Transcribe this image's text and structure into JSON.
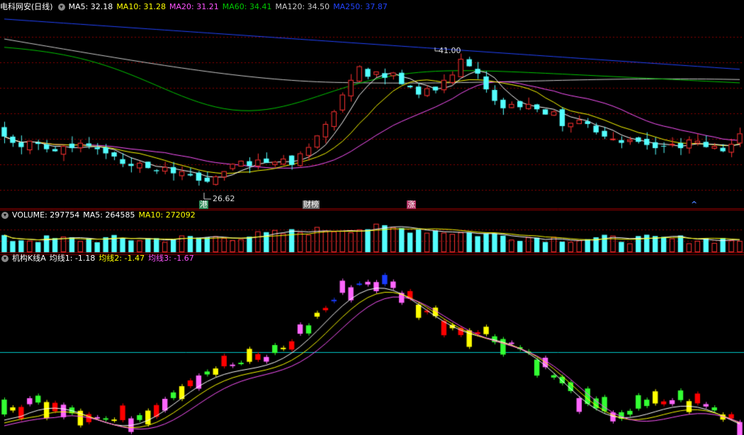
{
  "colors": {
    "bg": "#000000",
    "up": "#ff3232",
    "down": "#54ffff",
    "grid": "#8b0000",
    "ma5": "#ffffff",
    "ma10": "#ffff00",
    "ma20": "#ff55ff",
    "ma60": "#00c800",
    "ma120": "#cccccc",
    "ma250": "#2244ff",
    "line_cyan": "#00c8c8",
    "inst_red": "#ff0000",
    "inst_magenta": "#ff66ff",
    "inst_yellow": "#ffff00",
    "inst_green": "#33ff33",
    "inst_blue": "#1a3cff"
  },
  "price_panel": {
    "title": "电科网安(日线)",
    "ma_labels": [
      {
        "text": "MA5: 32.18",
        "color": "#ffffff"
      },
      {
        "text": "MA10: 31.28",
        "color": "#ffff00"
      },
      {
        "text": "MA20: 31.21",
        "color": "#ff55ff"
      },
      {
        "text": "MA60: 34.41",
        "color": "#00c800"
      },
      {
        "text": "MA120: 34.50",
        "color": "#cccccc"
      },
      {
        "text": "MA250: 37.87",
        "color": "#2244ff"
      }
    ],
    "high_label": "41.00",
    "low_label": "26.62",
    "markers": [
      {
        "text": "港",
        "bg": "#2e8b57",
        "fg": "#ffffff"
      },
      {
        "text": "财榜",
        "bg": "#666666",
        "fg": "#ffffff"
      },
      {
        "text": "涨",
        "bg": "#b03060",
        "fg": "#ffffff"
      },
      {
        "text": "^",
        "bg": "transparent",
        "fg": "#4a7dff"
      }
    ]
  },
  "volume_panel": {
    "labels": [
      {
        "text": "VOLUME: 297754",
        "color": "#ffffff"
      },
      {
        "text": "MA5: 264585",
        "color": "#ffffff"
      },
      {
        "text": "MA10: 272092",
        "color": "#ffff00"
      }
    ]
  },
  "indicator_panel": {
    "labels": [
      {
        "text": "机构K线A",
        "color": "#ffffff"
      },
      {
        "text": "均线1: -1.18",
        "color": "#ffffff"
      },
      {
        "text": "均线2: -1.47",
        "color": "#ffff00"
      },
      {
        "text": "均线3: -1.67",
        "color": "#ff55ff"
      }
    ]
  },
  "chart_data": {
    "type": "candlestick",
    "price_range": [
      24.5,
      43.0
    ],
    "close": [
      31.2,
      30.6,
      30.2,
      30.8,
      30.5,
      30.0,
      29.8,
      30.3,
      30.1,
      30.6,
      30.3,
      30.0,
      29.6,
      29.3,
      28.6,
      28.4,
      28.7,
      28.2,
      27.9,
      28.3,
      27.7,
      27.9,
      27.5,
      27.0,
      26.9,
      27.4,
      27.9,
      28.6,
      28.9,
      28.4,
      29.0,
      28.7,
      28.8,
      29.1,
      28.5,
      29.6,
      30.2,
      31.3,
      32.4,
      33.6,
      35.2,
      36.6,
      37.9,
      36.9,
      37.4,
      36.8,
      37.3,
      36.2,
      35.9,
      35.2,
      35.8,
      35.6,
      36.6,
      37.1,
      38.6,
      37.9,
      37.2,
      35.7,
      34.6,
      33.9,
      34.3,
      34.0,
      34.3,
      33.8,
      33.3,
      33.6,
      32.2,
      32.5,
      32.8,
      32.4,
      31.6,
      31.2,
      31.0,
      30.6,
      30.9,
      30.7,
      30.4,
      30.1,
      30.3,
      30.5,
      30.1,
      30.9,
      30.8,
      30.2,
      30.3,
      29.8,
      30.5,
      31.5
    ],
    "annotations": [
      "41.00",
      "26.62"
    ]
  }
}
